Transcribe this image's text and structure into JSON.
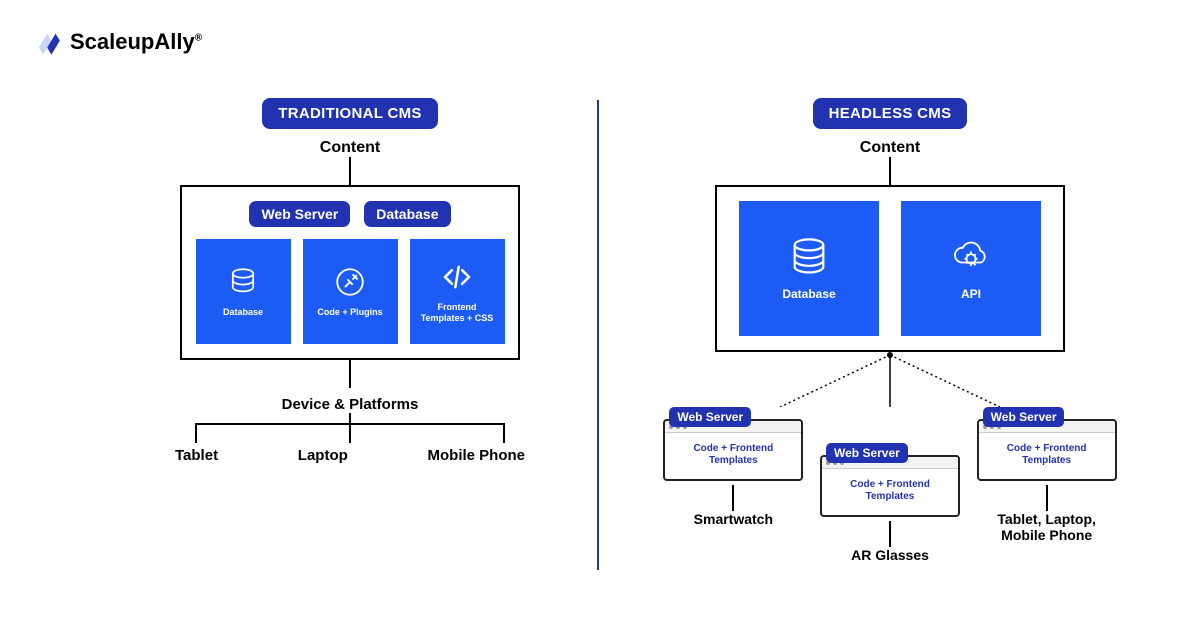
{
  "brand": {
    "name": "ScaleupAlly"
  },
  "left": {
    "title": "TRADITIONAL CMS",
    "content_label": "Content",
    "tags": {
      "web_server": "Web Server",
      "database": "Database"
    },
    "cards": {
      "db": "Database",
      "code": "Code + Plugins",
      "fe": "Frontend Templates + CSS"
    },
    "dev_platforms": "Device & Platforms",
    "endpoints": {
      "a": "Tablet",
      "b": "Laptop",
      "c": "Mobile Phone"
    }
  },
  "right": {
    "title": "HEADLESS CMS",
    "content_label": "Content",
    "cards": {
      "db": "Database",
      "api": "API"
    },
    "server_tag": "Web Server",
    "server_body": "Code + Frontend Templates",
    "endpoints": {
      "a": "Smartwatch",
      "b": "AR Glasses",
      "c": "Tablet, Laptop, Mobile Phone"
    }
  },
  "colors": {
    "brand_blue": "#2133b1",
    "card_blue": "#1c5cf5"
  }
}
